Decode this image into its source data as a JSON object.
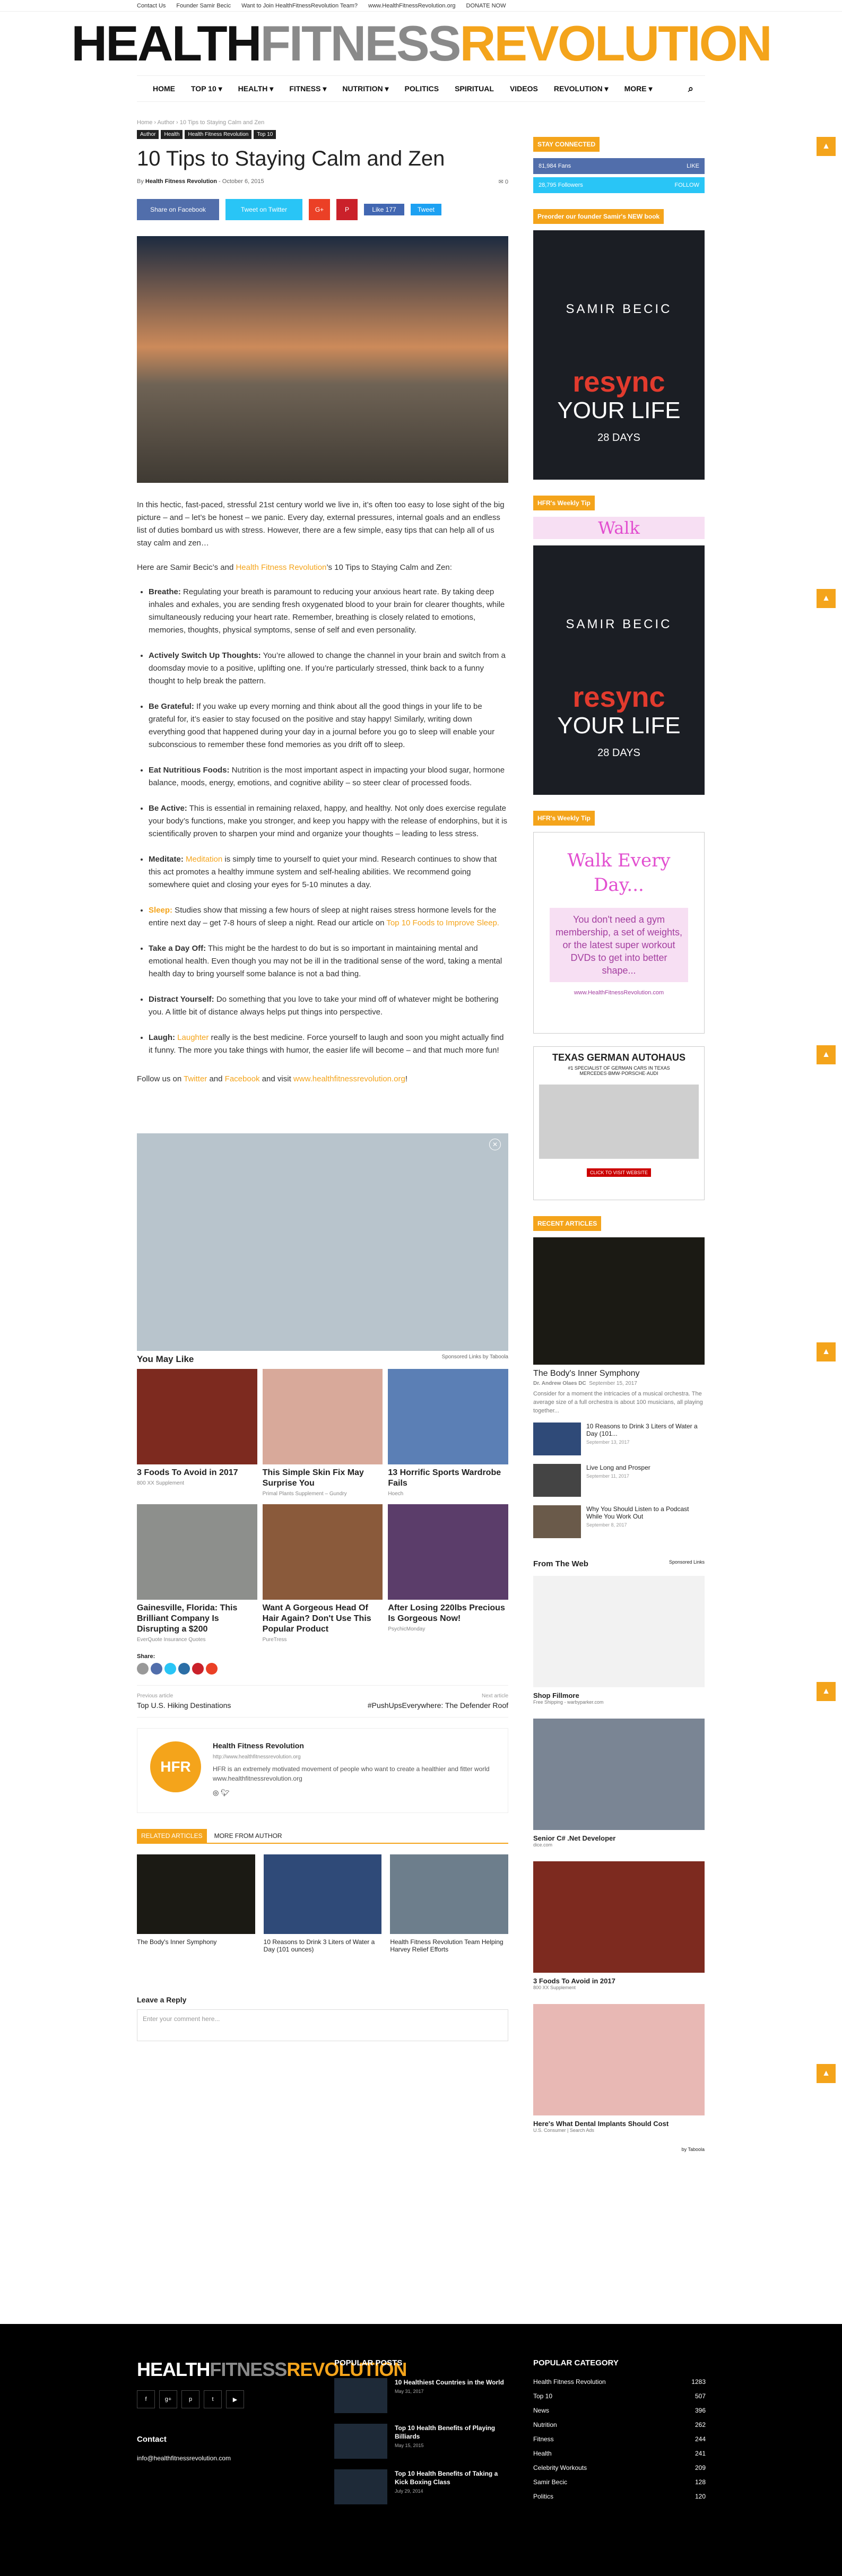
{
  "topbar": {
    "links": [
      "Contact Us",
      "Founder Samir Becic",
      "Want to Join HealthFitnessRevolution Team?",
      "www.HealthFitnessRevolution.org",
      "DONATE NOW"
    ]
  },
  "logo": {
    "a": "HEALTH",
    "b": "FITNESS",
    "c": "REVOLUTION"
  },
  "nav": {
    "items": [
      "HOME",
      "TOP 10 ▾",
      "HEALTH ▾",
      "FITNESS ▾",
      "NUTRITION ▾",
      "POLITICS",
      "SPIRITUAL",
      "VIDEOS",
      "REVOLUTION ▾",
      "MORE ▾"
    ]
  },
  "article": {
    "breadcrumb": "Home  ›  Author  ›  10 Tips to Staying Calm and Zen",
    "categories": [
      "Author",
      "Health",
      "Health Fitness Revolution",
      "Top 10"
    ],
    "title": "10 Tips to Staying Calm and Zen",
    "by": "By",
    "author": "Health Fitness Revolution",
    "date": "October 6, 2015",
    "comments": "0",
    "share": {
      "facebook": "Share on Facebook",
      "twitter": "Tweet on Twitter",
      "gplus": "G+",
      "pinterest": "P",
      "like": "Like 177",
      "tweet": "Tweet"
    },
    "intro1": "In this hectic, fast-paced, stressful 21st century world we live in, it’s often too easy to lose sight of the big picture – and – let’s be honest – we panic.  Every day, external pressures, internal goals and an endless list of duties bombard us with stress.  However, there are a few simple, easy tips that can help all of us stay calm and zen…",
    "intro2a": "Here are Samir Becic’s and ",
    "intro2b": "Health Fitness Revolution",
    "intro2c": "’s 10 Tips to Staying Calm and Zen:",
    "tips": [
      {
        "h": "Breathe:",
        "t": " Regulating your breath is paramount to reducing your anxious heart rate.  By taking deep inhales and exhales, you are sending fresh oxygenated blood to your brain for clearer thoughts, while simultaneously reducing your heart rate.  Remember, breathing is closely related to emotions, memories, thoughts, physical symptoms, sense of self and even personality."
      },
      {
        "h": "Actively Switch Up Thoughts:",
        "t": " You’re allowed to change the channel in your brain and switch from a doomsday movie to a positive, uplifting one.  If you’re particularly stressed, think back to a funny thought to help break the pattern."
      },
      {
        "h": "Be Grateful:",
        "t": " If you wake up every morning and think about all the good things in your life to be grateful for, it’s easier to stay focused on the positive and stay happy! Similarly, writing down everything good that happened during your day in a journal before you go to sleep will enable your subconscious to remember these fond memories as you drift off to sleep."
      },
      {
        "h": "Eat Nutritious Foods:",
        "t": " Nutrition is the most important aspect in impacting your blood sugar, hormone balance, moods, energy, emotions, and cognitive ability – so steer clear of processed foods."
      },
      {
        "h": "Be Active:",
        "t": "  This is essential in remaining relaxed, happy, and healthy.  Not only does exercise regulate your body’s functions, make you stronger, and keep you happy with the release of endorphins, but it is scientifically proven to sharpen your mind and organize your thoughts – leading to less stress."
      },
      {
        "h": "Meditate:",
        "link": "Meditation",
        "t": " is simply time to yourself to quiet your mind.  Research continues to show that this act promotes a healthy immune system and self-healing abilities.  We recommend going somewhere quiet and closing your eyes for 5-10 minutes a day."
      },
      {
        "h": "Sleep:",
        "t": " Studies show that missing a few hours of sleep at night raises stress hormone levels for the entire next day – get 7-8 hours of sleep a night. Read our article on ",
        "link2": "Top 10 Foods to Improve Sleep."
      },
      {
        "h": "Take a Day Off:",
        "t": " This might be the hardest to do but is so important in maintaining mental and emotional health. Even though you may not be ill in the traditional sense of the word, taking a mental health day to bring yourself some balance is not a bad thing."
      },
      {
        "h": "Distract Yourself:",
        "t": "  Do something that you love to take your mind off of whatever might be bothering you.  A little bit of distance always helps put things into perspective."
      },
      {
        "h": "Laugh:",
        "link": "Laughter",
        "t": " really is the best medicine.  Force yourself to laugh and soon you might actually find it funny.  The more you take things with humor, the easier life will become – and that much more fun!"
      }
    ],
    "follow": {
      "a": "Follow us on ",
      "tw": "Twitter",
      "b": " and ",
      "fb": "Facebook",
      "c": " and visit ",
      "site": "www.healthfitnessrevolution.org",
      "d": "!"
    }
  },
  "ymlike": {
    "title": "You May Like",
    "sponsor": "Sponsored Links by Taboola",
    "cards": [
      {
        "t": "3 Foods To Avoid in 2017",
        "s": "800 XX Supplement"
      },
      {
        "t": "This Simple Skin Fix May Surprise You",
        "s": "Primal Plants Supplement – Gundry"
      },
      {
        "t": "13 Horrific Sports Wardrobe Fails",
        "s": "Hoech"
      },
      {
        "t": "Gainesville, Florida: This Brilliant Company Is Disrupting a $200",
        "s": "EverQuote Insurance Quotes"
      },
      {
        "t": "Want A Gorgeous Head Of Hair Again? Don't Use This Popular Product",
        "s": "PureTress"
      },
      {
        "t": "After Losing 220lbs Precious Is Gorgeous Now!",
        "s": "PsychicMonday"
      }
    ]
  },
  "shareLabel": "Share:",
  "prevnext": {
    "pl": "Previous article",
    "pt": "Top U.S. Hiking Destinations",
    "nl": "Next article",
    "nt": "#PushUpsEverywhere: The Defender Roof"
  },
  "authorbox": {
    "name": "Health Fitness Revolution",
    "url": "http://www.healthfitnessrevolution.org",
    "bio": "HFR is an extremely motivated movement of people who want to create a healthier and fitter world www.healthfitnessrevolution.org",
    "avatar": "HFR"
  },
  "related": {
    "tab1": "RELATED ARTICLES",
    "tab2": "MORE FROM AUTHOR",
    "items": [
      "The Body's Inner Symphony",
      "10 Reasons to Drink 3 Liters of Water a Day (101 ounces)",
      "Health Fitness Revolution Team Helping Harvey Relief Efforts"
    ]
  },
  "reply": {
    "title": "Leave a Reply",
    "placeholder": "Enter your comment here..."
  },
  "side": {
    "stay": "STAY CONNECTED",
    "fb": "81,984 Fans",
    "fbAct": "LIKE",
    "tw": "28,795 Followers",
    "twAct": "FOLLOW",
    "bookTitle": "Preorder our founder Samir's NEW book",
    "book": {
      "n": "SAMIR BECIC",
      "r": "resync",
      "y": "YOUR LIFE",
      "d": "28 DAYS"
    },
    "tip1": "HFR's Weekly Tip",
    "walk": "Walk",
    "tip2": "HFR's Weekly Tip",
    "tip2h": "Walk Every Day...",
    "tip2b": "You don't need a gym membership, a set of weights, or the latest super workout DVDs to get into better shape...",
    "tip2u": "www.HealthFitnessRevolution.com",
    "tga": {
      "h": "TEXAS GERMAN AUTOHAUS",
      "s": "#1 SPECIALIST OF GERMAN CARS IN TEXAS MERCEDES·BMW·PORSCHE·AUDI",
      "c": "CLICK TO VISIT WEBSITE"
    },
    "recentTitle": "RECENT ARTICLES",
    "recentMain": {
      "t": "The Body's Inner Symphony",
      "a": "Dr. Andrew Olaes DC",
      "d": "September 15, 2017",
      "e": "Consider for a moment the intricacies of a musical orchestra.  The average size of a full orchestra is about 100 musicians, all playing together..."
    },
    "recent": [
      {
        "t": "10 Reasons to Drink 3 Liters of Water a Day (101...",
        "d": "September 13, 2017"
      },
      {
        "t": "Live Long and Prosper",
        "d": "September 11, 2017"
      },
      {
        "t": "Why You Should Listen to a Podcast While You Work Out",
        "d": "September 8, 2017"
      }
    ],
    "ftwTitle": "From The Web",
    "ftwSponsor": "Sponsored Links",
    "ftw": [
      {
        "t": "Shop Fillmore",
        "s": "Free Shipping - warbyparker.com"
      },
      {
        "t": "Senior C# .Net Developer",
        "s": "dice.com"
      },
      {
        "t": "3 Foods To Avoid in 2017",
        "s": "800 XX Supplement"
      },
      {
        "t": "Here's What Dental Implants Should Cost",
        "s": "U.S. Consumer | Search Ads"
      }
    ],
    "taboola": "by Taboola"
  },
  "footer": {
    "logoA": "HEALTH",
    "logoB": "FITNESS",
    "logoC": "REVOLUTION",
    "contact": "Contact",
    "email": "info@healthfitnessrevolution.com",
    "ppTitle": "POPULAR POSTS",
    "pp": [
      {
        "t": "10 Healthiest Countries in the World",
        "d": "May 31, 2017"
      },
      {
        "t": "Top 10 Health Benefits of Playing Billiards",
        "d": "May 15, 2015"
      },
      {
        "t": "Top 10 Health Benefits of Taking a Kick Boxing Class",
        "d": "July 29, 2014"
      }
    ],
    "pcTitle": "POPULAR CATEGORY",
    "pc": [
      [
        "Health Fitness Revolution",
        "1283"
      ],
      [
        "Top 10",
        "507"
      ],
      [
        "News",
        "396"
      ],
      [
        "Nutrition",
        "262"
      ],
      [
        "Fitness",
        "244"
      ],
      [
        "Health",
        "241"
      ],
      [
        "Celebrity Workouts",
        "209"
      ],
      [
        "Samir Becic",
        "128"
      ],
      [
        "Politics",
        "120"
      ]
    ]
  },
  "colors": {
    "accent": "#f4a41b",
    "facebook": "#516eab",
    "twitter": "#29c5f6",
    "gplus": "#eb4026",
    "pinterest": "#ca212a"
  }
}
